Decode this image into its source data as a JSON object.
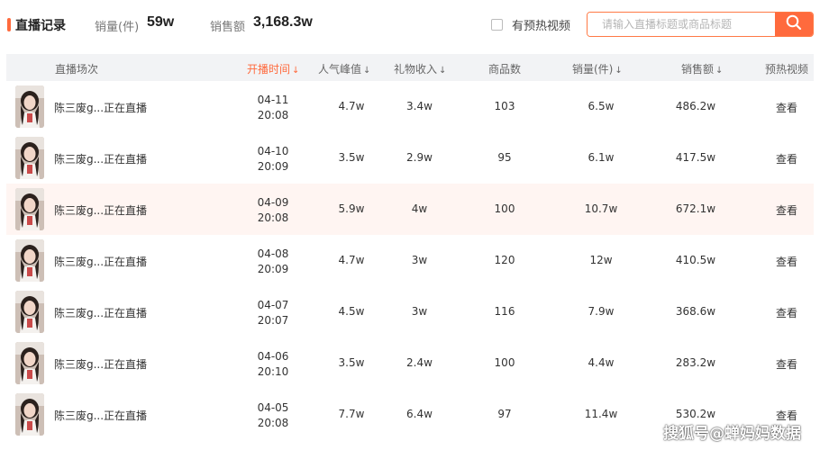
{
  "header": {
    "title": "直播记录",
    "sales_count_label": "销量(件)",
    "sales_count_value": "59w",
    "sales_amount_label": "销售额",
    "sales_amount_value": "3,168.3w",
    "preheat_label": "有预热视频",
    "search_placeholder": "请输入直播标题或商品标题"
  },
  "columns": [
    {
      "label": "直播场次",
      "sortable": false,
      "active": false
    },
    {
      "label": "开播时间",
      "sortable": true,
      "active": true
    },
    {
      "label": "人气峰值",
      "sortable": true,
      "active": false
    },
    {
      "label": "礼物收入",
      "sortable": true,
      "active": false
    },
    {
      "label": "商品数",
      "sortable": false,
      "active": false
    },
    {
      "label": "销量(件)",
      "sortable": true,
      "active": false
    },
    {
      "label": "销售额",
      "sortable": true,
      "active": false
    },
    {
      "label": "预热视频",
      "sortable": false,
      "active": false
    }
  ],
  "rows": [
    {
      "name": "陈三废g...正在直播",
      "date": "04-11",
      "time": "20:08",
      "peak": "4.7w",
      "gift": "3.4w",
      "products": "103",
      "sales": "6.5w",
      "amount": "486.2w",
      "action": "查看"
    },
    {
      "name": "陈三废g...正在直播",
      "date": "04-10",
      "time": "20:09",
      "peak": "3.5w",
      "gift": "2.9w",
      "products": "95",
      "sales": "6.1w",
      "amount": "417.5w",
      "action": "查看"
    },
    {
      "name": "陈三废g...正在直播",
      "date": "04-09",
      "time": "20:08",
      "peak": "5.9w",
      "gift": "4w",
      "products": "100",
      "sales": "10.7w",
      "amount": "672.1w",
      "action": "查看",
      "highlighted": true
    },
    {
      "name": "陈三废g...正在直播",
      "date": "04-08",
      "time": "20:09",
      "peak": "4.7w",
      "gift": "3w",
      "products": "120",
      "sales": "12w",
      "amount": "410.5w",
      "action": "查看"
    },
    {
      "name": "陈三废g...正在直播",
      "date": "04-07",
      "time": "20:07",
      "peak": "4.5w",
      "gift": "3w",
      "products": "116",
      "sales": "7.9w",
      "amount": "368.6w",
      "action": "查看"
    },
    {
      "name": "陈三废g...正在直播",
      "date": "04-06",
      "time": "20:10",
      "peak": "3.5w",
      "gift": "2.4w",
      "products": "100",
      "sales": "4.4w",
      "amount": "283.2w",
      "action": "查看"
    },
    {
      "name": "陈三废g...正在直播",
      "date": "04-05",
      "time": "20:08",
      "peak": "7.7w",
      "gift": "6.4w",
      "products": "97",
      "sales": "11.4w",
      "amount": "530.2w",
      "action": "查看"
    }
  ],
  "watermark": "搜狐号@蝉妈妈数据",
  "icons": {
    "search": "search-icon",
    "sort": "sort-down-icon",
    "thumbnail": "avatar-thumbnail"
  },
  "colors": {
    "accent": "#ff6a3d",
    "highlight_row": "#fff5f2",
    "header_bg": "#f2f3f5"
  }
}
